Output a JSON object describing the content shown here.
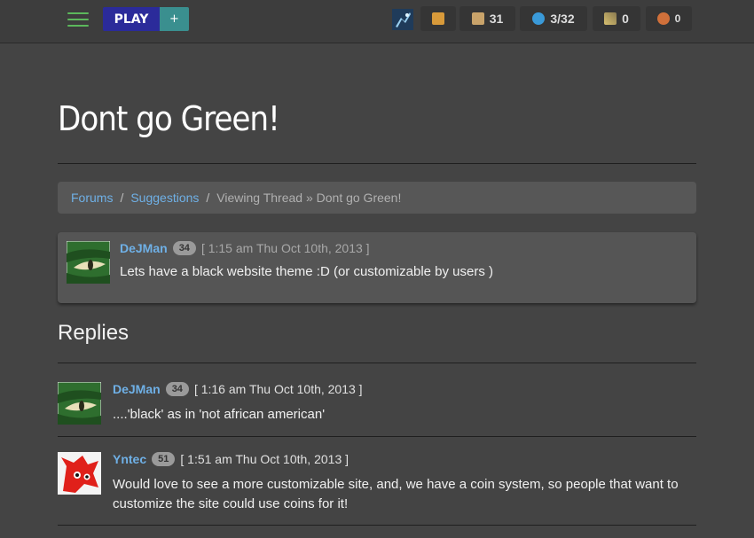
{
  "topbar": {
    "menu_icon": "hamburger-icon",
    "play_label": "PLAY",
    "plus_label": "+",
    "stats": [
      {
        "icon": "box-icon",
        "value": ""
      },
      {
        "icon": "chest-icon",
        "value": "31"
      },
      {
        "icon": "globe-icon",
        "value": "3/32"
      },
      {
        "icon": "medal-icon",
        "value": "0"
      },
      {
        "icon": "key-icon",
        "value": "0"
      }
    ]
  },
  "page": {
    "title": "Dont go Green!"
  },
  "breadcrumb": {
    "forums": "Forums",
    "sep1": "/",
    "suggestions": "Suggestions",
    "sep2": "/",
    "current": "Viewing Thread » Dont go Green!"
  },
  "post": {
    "username": "DeJMan",
    "level": "34",
    "timestamp": "[ 1:15 am Thu Oct 10th, 2013 ]",
    "body": "Lets have a black website theme :D (or customizable by users )"
  },
  "replies_title": "Replies",
  "replies": [
    {
      "username": "DeJMan",
      "level": "34",
      "timestamp": "[ 1:16 am Thu Oct 10th, 2013 ]",
      "body": "....'black' as in 'not african american'"
    },
    {
      "username": "Yntec",
      "level": "51",
      "timestamp": "[ 1:51 am Thu Oct 10th, 2013 ]",
      "body": "Would love to see a more customizable site, and, we have a coin system, so people that want to customize the site could use coins for it!"
    }
  ],
  "colors": {
    "background": "#444444",
    "link": "#6fb0e6",
    "play": "#2b2b9a",
    "plus": "#3a8f8f",
    "menu": "#5cb85c"
  }
}
